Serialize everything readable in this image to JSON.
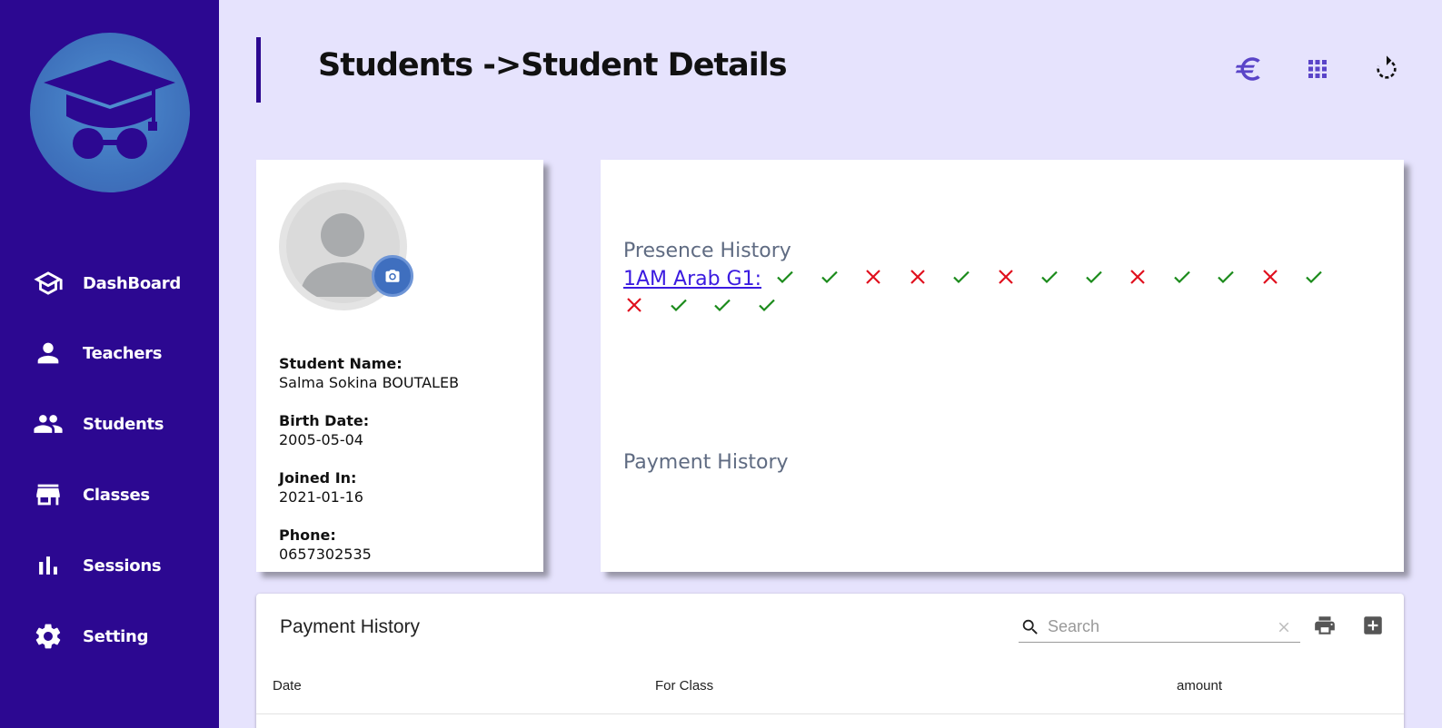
{
  "sidebar": {
    "items": [
      {
        "label": "DashBoard",
        "icon": "school-icon"
      },
      {
        "label": "Teachers",
        "icon": "person-icon"
      },
      {
        "label": "Students",
        "icon": "people-icon"
      },
      {
        "label": "Classes",
        "icon": "store-icon"
      },
      {
        "label": "Sessions",
        "icon": "bar-chart-icon"
      },
      {
        "label": "Setting",
        "icon": "gear-icon"
      }
    ]
  },
  "header": {
    "title": "Students ->Student Details",
    "actions": [
      "euro-icon",
      "apps-grid-icon",
      "refresh-icon"
    ]
  },
  "profile": {
    "name_label": "Student Name:",
    "name": "Salma Sokina BOUTALEB",
    "birth_label": "Birth Date:",
    "birth": "2005-05-04",
    "joined_label": "Joined In:",
    "joined": "2021-01-16",
    "phone_label": "Phone:",
    "phone": "0657302535"
  },
  "presence": {
    "title": "Presence History",
    "class_name": "1AM Arab G1:",
    "records": [
      true,
      true,
      false,
      false,
      true,
      false,
      true,
      true,
      false,
      true,
      true,
      false,
      true,
      false,
      true,
      true,
      true
    ]
  },
  "payment_summary": {
    "title": "Payment History"
  },
  "payment_table": {
    "title": "Payment History",
    "search_placeholder": "Search",
    "columns": [
      "Date",
      "For Class",
      "amount"
    ]
  },
  "colors": {
    "sidebar": "#2c0891",
    "background": "#e6e3fd",
    "present": "#1a8a1a",
    "absent": "#e0101e",
    "accent_icon": "#5a44c8"
  }
}
